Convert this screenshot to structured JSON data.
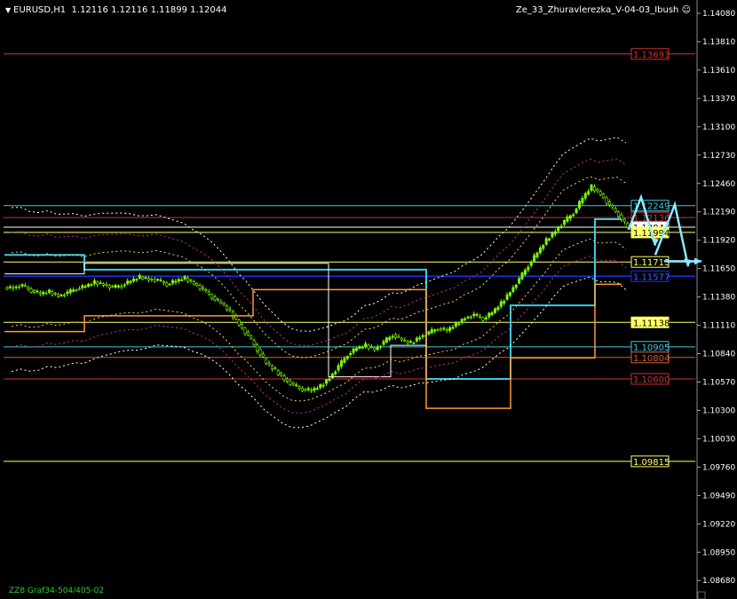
{
  "header": {
    "symbol": "EURUSD,H1",
    "ohlc": "1.12116 1.12116 1.11899 1.12044",
    "indicator": "Ze_33_Zhuravlerezka_V-04-03_Ibush",
    "smiley": "☺"
  },
  "footer": {
    "text": "ZZ8 Graf34-504/405-02"
  },
  "colors": {
    "background": "#000000",
    "grid": "#2a2a2a",
    "axis": "#ffffff",
    "bull": "#7CFC00",
    "bear": "#000000",
    "candle_outline": "#7CFC00",
    "red_level": "#d03030",
    "yellow_level": "#ffff66",
    "cyan_level": "#40c8e0",
    "blue_level": "#2030e0",
    "orange_level": "#ff9933",
    "arrow": "#8de8ff"
  },
  "chart_data": {
    "type": "candlestick",
    "y_axis_ticks": [
      "1.14080",
      "1.13810",
      "1.13610",
      "1.13370",
      "1.13100",
      "1.12730",
      "1.12460",
      "1.12190",
      "1.11920",
      "1.11650",
      "1.11380",
      "1.11110",
      "1.10840",
      "1.10570",
      "1.10300",
      "1.10030",
      "1.09760",
      "1.09490",
      "1.09220",
      "1.08950",
      "1.08680"
    ],
    "ylim": [
      1.0866,
      1.1408
    ],
    "levels": [
      {
        "label": "1.13693",
        "value": 1.13693,
        "color": "#d03030",
        "label_bg": "#000000",
        "label_color": "#d03030"
      },
      {
        "label": "1.12249",
        "value": 1.12249,
        "color": "#40c8e0",
        "label_bg": "#000000",
        "label_color": "#40c8e0"
      },
      {
        "label": "1.12136",
        "value": 1.12136,
        "color": "#d03030",
        "label_bg": "#000000",
        "label_color": "#d03030"
      },
      {
        "label": "1.12044",
        "value": 1.12044,
        "color": "#ffffff",
        "label_bg": "#ffffff",
        "label_color": "#000000"
      },
      {
        "label": "1.11994",
        "value": 1.11994,
        "color": "#ffff66",
        "label_bg": "#ffff66",
        "label_color": "#000000"
      },
      {
        "label": "1.11713",
        "value": 1.11713,
        "color": "#ffff66",
        "label_bg": "#000000",
        "label_color": "#ffff66"
      },
      {
        "label": "1.11577",
        "value": 1.11577,
        "color": "#2030e0",
        "label_bg": "#000000",
        "label_color": "#4060ff"
      },
      {
        "label": "1.11138",
        "value": 1.11138,
        "color": "#ffff66",
        "label_bg": "#ffff66",
        "label_color": "#000000"
      },
      {
        "label": "1.10905",
        "value": 1.10905,
        "color": "#40c8e0",
        "label_bg": "#000000",
        "label_color": "#40c8e0"
      },
      {
        "label": "1.10804",
        "value": 1.10804,
        "color": "#d06030",
        "label_bg": "#000000",
        "label_color": "#d06030"
      },
      {
        "label": "1.10600",
        "value": 1.106,
        "color": "#d03030",
        "label_bg": "#000000",
        "label_color": "#d03030"
      },
      {
        "label": "1.09815",
        "value": 1.09815,
        "color": "#ffff66",
        "label_bg": "#000000",
        "label_color": "#ffff66"
      }
    ],
    "close_path": [
      1.1147,
      1.1149,
      1.1144,
      1.1141,
      1.1143,
      1.1139,
      1.1142,
      1.1146,
      1.1148,
      1.1152,
      1.115,
      1.1147,
      1.1149,
      1.1153,
      1.1157,
      1.1155,
      1.1154,
      1.115,
      1.1153,
      1.1156,
      1.1151,
      1.1145,
      1.1138,
      1.1132,
      1.1124,
      1.1112,
      1.1101,
      1.1088,
      1.1075,
      1.1068,
      1.106,
      1.1054,
      1.105,
      1.1049,
      1.1053,
      1.1061,
      1.1072,
      1.1083,
      1.1089,
      1.1092,
      1.1088,
      1.1095,
      1.1102,
      1.1097,
      1.1094,
      1.11,
      1.1104,
      1.1108,
      1.1106,
      1.1112,
      1.1118,
      1.1121,
      1.1117,
      1.1123,
      1.1132,
      1.1143,
      1.1155,
      1.1168,
      1.118,
      1.1192,
      1.1201,
      1.121,
      1.1218,
      1.1232,
      1.1243,
      1.1236,
      1.1225,
      1.1216,
      1.1204
    ],
    "projection_arrows": [
      [
        1.1202,
        1.1233,
        1.1187
      ],
      [
        1.1178,
        1.1226,
        1.1167
      ],
      [
        1.1172,
        1.1172
      ]
    ]
  }
}
